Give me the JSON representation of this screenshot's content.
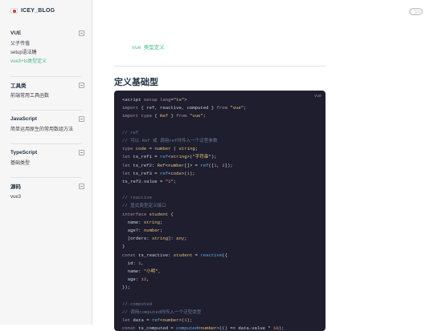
{
  "brand": {
    "title": "ICEY_BLOG"
  },
  "sidebar": {
    "groups": [
      {
        "title": "VUE",
        "items": [
          "父子传值",
          "setup语法糖",
          "vue3+ts类型定义"
        ]
      },
      {
        "title": "工具类",
        "items": [
          "前端常用工具函数"
        ]
      },
      {
        "title": "JavaScript",
        "items": [
          "简单运用原生的常用数组方法"
        ]
      },
      {
        "title": "TypeScript",
        "items": [
          "基础类型"
        ]
      },
      {
        "title": "源码",
        "items": [
          "vue3"
        ]
      }
    ]
  },
  "content": {
    "breadcrumb_code": "vue",
    "breadcrumb_text": "类型定义",
    "heading": "定义基础型",
    "code_lang": "vue",
    "code_lines": [
      "<script setup lang=\"ts\">",
      "import { ref, reactive, computed } from \"vue\";",
      "import type { Ref } from \"vue\";",
      "",
      "// ref",
      "// 可以 Ref 或 调用ref时传入一个泛型参数",
      "type code = number | string;",
      "let ts_ref1 = ref<string>(\"字符串\");",
      "let ts_ref2: Ref<number[]> = ref([1, 2]);",
      "let ts_ref3 = ref<code>(1);",
      "ts_ref3.value = \"1\";",
      "",
      "// reactive",
      "// 显式类型定义接口",
      "interface student {",
      "  name: string;",
      "  age?: number;",
      "  [orders: string]: any;",
      "}",
      "const ts_reactive: student = reactive({",
      "  id: 1,",
      "  name: \"小明\",",
      "  age: 12,",
      "});",
      "",
      "// computed",
      "// 调用computed时传入一个泛型类型",
      "let data = ref<number>(1);",
      "const ts_computed = computed<number>(() => data.value * 10);"
    ]
  },
  "colors": {
    "accent": "#42b883",
    "code_bg": "#1e1e2e"
  }
}
